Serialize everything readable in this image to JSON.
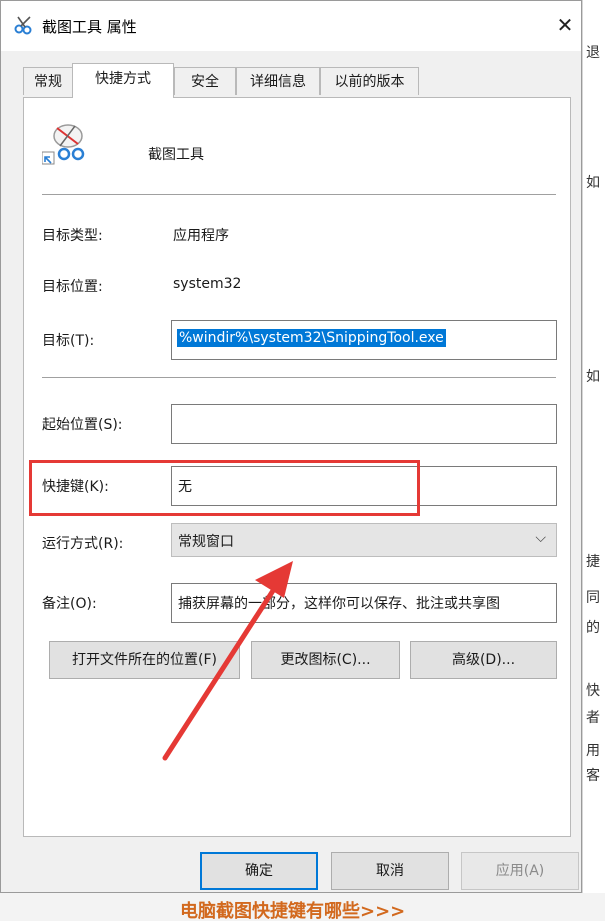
{
  "window": {
    "title": "截图工具 属性",
    "close_symbol": "✕"
  },
  "tabs": [
    {
      "label": "常规"
    },
    {
      "label": "快捷方式"
    },
    {
      "label": "安全"
    },
    {
      "label": "详细信息"
    },
    {
      "label": "以前的版本"
    }
  ],
  "shortcut": {
    "app_name": "截图工具",
    "target_type_label": "目标类型:",
    "target_type_value": "应用程序",
    "target_location_label": "目标位置:",
    "target_location_value": "system32",
    "target_label": "目标(T):",
    "target_value": "%windir%\\system32\\SnippingTool.exe",
    "start_in_label": "起始位置(S):",
    "start_in_value": "",
    "hotkey_label": "快捷键(K):",
    "hotkey_value": "无",
    "run_label": "运行方式(R):",
    "run_value": "常规窗口",
    "comment_label": "备注(O):",
    "comment_value": "捕获屏幕的一部分，这样你可以保存、批注或共享图"
  },
  "action_buttons": {
    "open_location": "打开文件所在的位置(F)",
    "change_icon": "更改图标(C)...",
    "advanced": "高级(D)..."
  },
  "footer_buttons": {
    "ok": "确定",
    "cancel": "取消",
    "apply": "应用(A)"
  },
  "background": {
    "side_chars": [
      "退",
      "如",
      "如",
      "捷",
      "同",
      "的",
      "快",
      "者",
      "用",
      "客"
    ],
    "bottom_link": "电脑截图快捷键有哪些>>>"
  },
  "colors": {
    "accent": "#0078d7",
    "highlight_red": "#e53935"
  }
}
